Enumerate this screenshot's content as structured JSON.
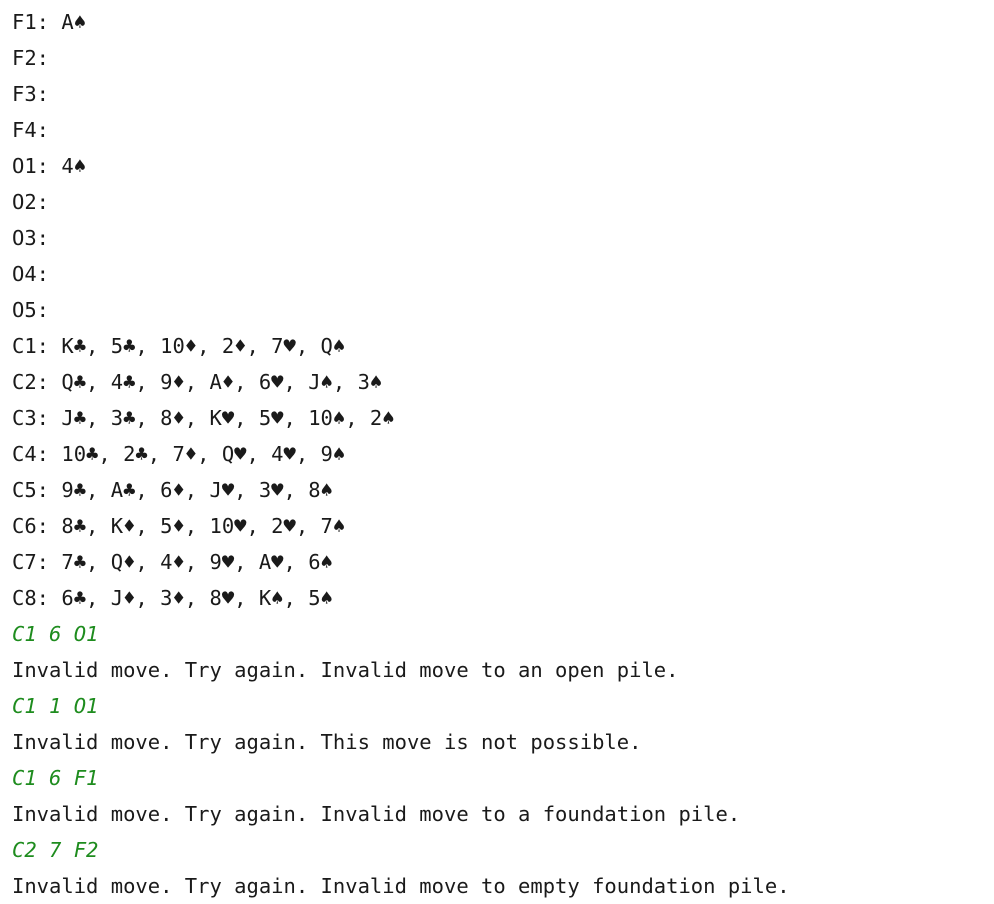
{
  "lines": [
    {
      "type": "state",
      "name": "foundation-1-line",
      "text": "F1: A♠"
    },
    {
      "type": "state",
      "name": "foundation-2-line",
      "text": "F2:"
    },
    {
      "type": "state",
      "name": "foundation-3-line",
      "text": "F3:"
    },
    {
      "type": "state",
      "name": "foundation-4-line",
      "text": "F4:"
    },
    {
      "type": "state",
      "name": "open-pile-1-line",
      "text": "O1: 4♠"
    },
    {
      "type": "state",
      "name": "open-pile-2-line",
      "text": "O2:"
    },
    {
      "type": "state",
      "name": "open-pile-3-line",
      "text": "O3:"
    },
    {
      "type": "state",
      "name": "open-pile-4-line",
      "text": "O4:"
    },
    {
      "type": "state",
      "name": "open-pile-5-line",
      "text": "O5:"
    },
    {
      "type": "state",
      "name": "cascade-1-line",
      "text": "C1: K♣, 5♣, 10♦, 2♦, 7♥, Q♠"
    },
    {
      "type": "state",
      "name": "cascade-2-line",
      "text": "C2: Q♣, 4♣, 9♦, A♦, 6♥, J♠, 3♠"
    },
    {
      "type": "state",
      "name": "cascade-3-line",
      "text": "C3: J♣, 3♣, 8♦, K♥, 5♥, 10♠, 2♠"
    },
    {
      "type": "state",
      "name": "cascade-4-line",
      "text": "C4: 10♣, 2♣, 7♦, Q♥, 4♥, 9♠"
    },
    {
      "type": "state",
      "name": "cascade-5-line",
      "text": "C5: 9♣, A♣, 6♦, J♥, 3♥, 8♠"
    },
    {
      "type": "state",
      "name": "cascade-6-line",
      "text": "C6: 8♣, K♦, 5♦, 10♥, 2♥, 7♠"
    },
    {
      "type": "state",
      "name": "cascade-7-line",
      "text": "C7: 7♣, Q♦, 4♦, 9♥, A♥, 6♠"
    },
    {
      "type": "state",
      "name": "cascade-8-line",
      "text": "C8: 6♣, J♦, 3♦, 8♥, K♠, 5♠"
    },
    {
      "type": "command",
      "name": "move-command-1",
      "text": "C1 6 O1"
    },
    {
      "type": "message",
      "name": "move-feedback-1",
      "text": "Invalid move. Try again. Invalid move to an open pile."
    },
    {
      "type": "command",
      "name": "move-command-2",
      "text": "C1 1 O1"
    },
    {
      "type": "message",
      "name": "move-feedback-2",
      "text": "Invalid move. Try again. This move is not possible."
    },
    {
      "type": "command",
      "name": "move-command-3",
      "text": "C1 6 F1"
    },
    {
      "type": "message",
      "name": "move-feedback-3",
      "text": "Invalid move. Try again. Invalid move to a foundation pile."
    },
    {
      "type": "command",
      "name": "move-command-4",
      "text": "C2 7 F2"
    },
    {
      "type": "message",
      "name": "move-feedback-4",
      "text": "Invalid move. Try again. Invalid move to empty foundation pile."
    }
  ],
  "colors": {
    "text": "#1a1a1a",
    "command": "#1e8c1e",
    "background": "#ffffff"
  }
}
